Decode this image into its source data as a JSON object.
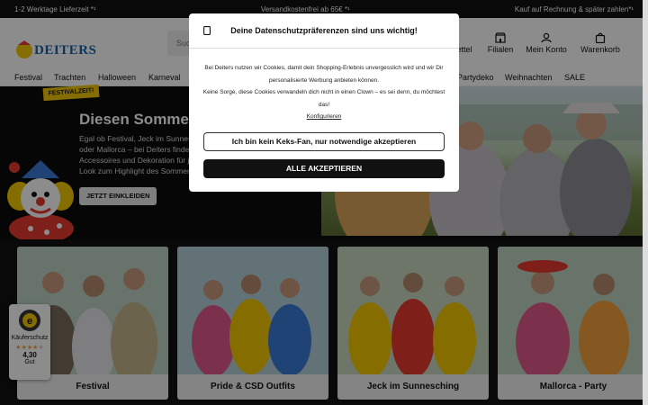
{
  "topbar": {
    "left": "1-2 Werktage Lieferzeit *¹",
    "center": "Versandkostenfrei ab 65€ *¹",
    "right": "Kauf auf Rechnung & später zahlen*¹"
  },
  "header": {
    "logo": "DEITERS",
    "search_placeholder": "Suc",
    "wishlist": "ettel",
    "stores": "Filialen",
    "account": "Mein Konto",
    "cart": "Warenkorb"
  },
  "nav": {
    "items": [
      "Festival",
      "Trachten",
      "Halloween",
      "Karneval",
      "Partydeko",
      "Weihnachten",
      "SALE"
    ]
  },
  "hero": {
    "badge": "FESTIVALZEIT!",
    "title": "Diesen Sommer",
    "text_lines": [
      "Egal ob Festival, Jeck im Sunnesc",
      "oder Mallorca – bei Deiters finde",
      "Accessoires und Dekoration für j",
      "Look zum Highlight des Sommer"
    ],
    "button": "JETZT EINKLEIDEN"
  },
  "cards": [
    {
      "label": "Festival"
    },
    {
      "label": "Pride & CSD Outfits"
    },
    {
      "label": "Jeck im Sunnesching"
    },
    {
      "label": "Mallorca - Party"
    }
  ],
  "trust": {
    "label": "Käuferschutz",
    "rating": "4,30",
    "grade": "Gut",
    "stars": 4.3
  },
  "consent": {
    "title": "Deine Datenschutzpräferenzen sind uns wichtig!",
    "text1": "Bei Deiters nutzen wir Cookies, damit dein Shopping-Erlebnis unvergesslich wird und wir Dir personalisierte Werbung anbieten können.",
    "text2": "Keine Sorge, diese Cookies verwandeln dich nicht in einen Clown – es sei denn, du möchtest das!",
    "configure": "Konfigurieren",
    "btn_essential": "Ich bin kein Keks-Fan, nur notwendige akzeptieren",
    "btn_all": "ALLE AKZEPTIEREN"
  },
  "colors": {
    "brand": "#1a63a8",
    "dark": "#111111",
    "badge": "#f2c700"
  }
}
